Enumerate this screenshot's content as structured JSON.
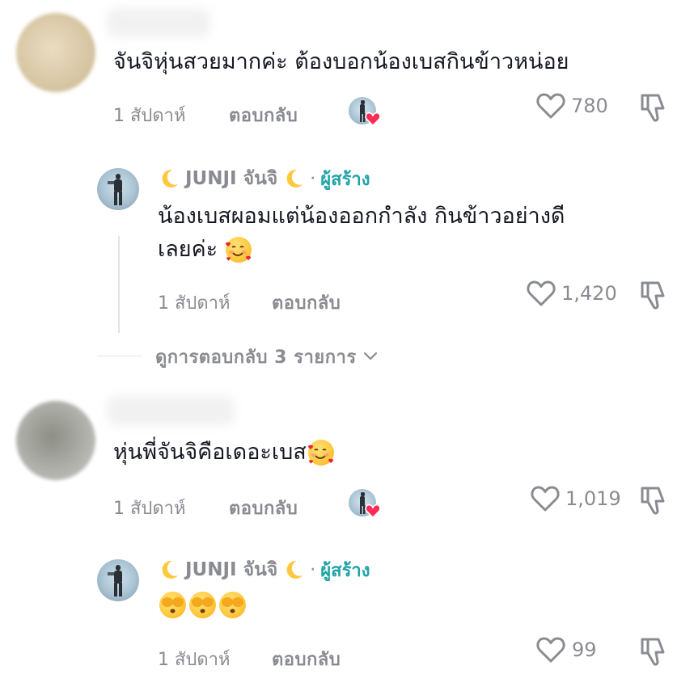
{
  "comments": [
    {
      "text": "จันจิหุ่นสวยมากค่ะ ต้องบอกน้องเบสกินข้าวหน่อย",
      "time": "1 สัปดาห์",
      "reply_label": "ตอบกลับ",
      "likes": "780"
    },
    {
      "text": "หุ่นพี่จันจิคือเดอะเบส",
      "time": "1 สัปดาห์",
      "reply_label": "ตอบกลับ",
      "likes": "1,019"
    }
  ],
  "replies": [
    {
      "author": "JUNJI จันจิ",
      "creator_badge": "ผู้สร้าง",
      "separator": "·",
      "text_line1": "น้องเบสผอมแต่น้องออกกำลัง กินข้าวอย่างดี",
      "text_line2": "เลยค่ะ",
      "time": "1 สัปดาห์",
      "reply_label": "ตอบกลับ",
      "likes": "1,420"
    },
    {
      "author": "JUNJI จันจิ",
      "creator_badge": "ผู้สร้าง",
      "separator": "·",
      "time": "1 สัปดาห์",
      "reply_label": "ตอบกลับ",
      "likes": "99"
    }
  ],
  "view_replies": "ดูการตอบกลับ 3 รายการ",
  "icons": {
    "like": "heart-outline-icon",
    "dislike": "thumbs-down-outline-icon",
    "expand": "chevron-down-icon",
    "moon": "crescent-moon-emoji",
    "love_face": "smiling-face-with-hearts-emoji",
    "covering_eyes": "face-covering-eyes-emoji",
    "creator_liked": "heart-badge-icon"
  },
  "colors": {
    "text": "#161823",
    "muted": "#8a8b91",
    "creator": "#1fa3a8",
    "heart": "#fe2c55"
  }
}
